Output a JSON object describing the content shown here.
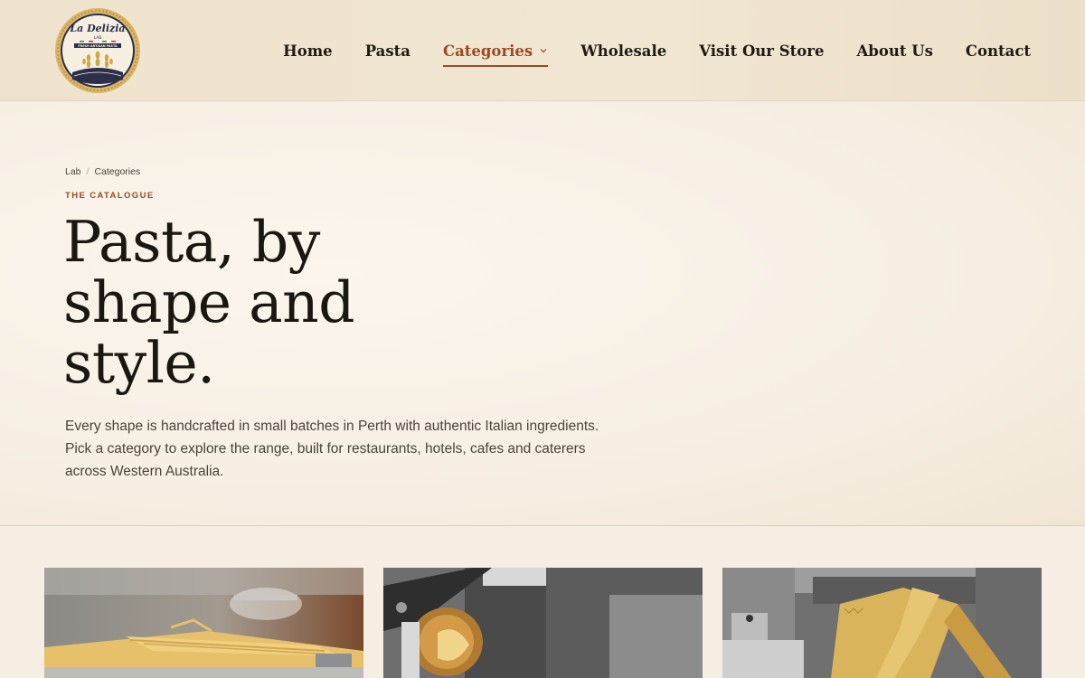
{
  "brand": {
    "name": "La Delizia",
    "sub": "LAB",
    "tagline": "FRESH ARTISAN PASTA",
    "colors": {
      "accent": "#9a4a22",
      "gold": "#c9a349",
      "navy": "#2b2f4a"
    }
  },
  "nav": {
    "items": [
      {
        "label": "Home"
      },
      {
        "label": "Pasta"
      },
      {
        "label": "Categories",
        "active": true,
        "icon": "chevron-down-icon"
      },
      {
        "label": "Wholesale"
      },
      {
        "label": "Visit Our Store"
      },
      {
        "label": "About Us"
      },
      {
        "label": "Contact"
      }
    ]
  },
  "breadcrumb": {
    "home": "Lab",
    "separator": "/",
    "current": "Categories"
  },
  "hero": {
    "eyebrow": "THE CATALOGUE",
    "title_line1": "Pasta, by",
    "title_line2": "shape and",
    "title_line3": "style.",
    "lead": "Every shape is handcrafted in small batches in Perth with authentic Italian ingredients. Pick a category to explore the range, built for restaurants, hotels, cafes and caterers across Western Australia."
  },
  "cards": [
    {
      "image": "pasta-sheets-photo"
    },
    {
      "image": "pasta-extruder-photo"
    },
    {
      "image": "pasta-cutter-photo"
    }
  ]
}
